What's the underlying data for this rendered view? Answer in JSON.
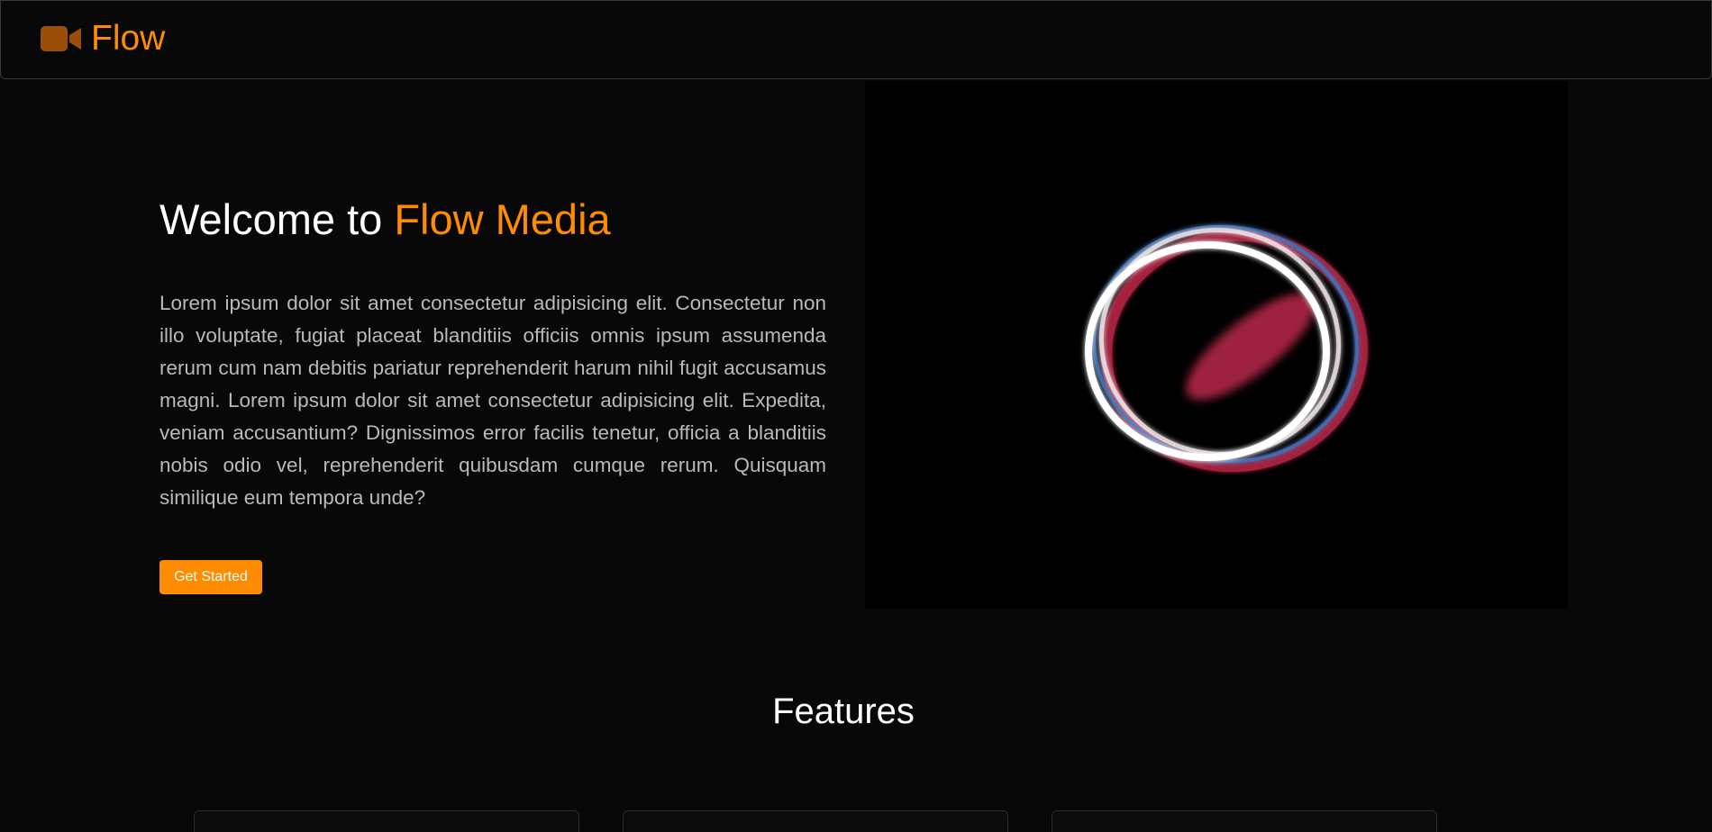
{
  "nav": {
    "brand": "Flow",
    "brand_icon": "video-camera-icon",
    "accent_color": "#ff8c00"
  },
  "hero": {
    "title_prefix": "Welcome to ",
    "title_highlight": "Flow Media",
    "description": "Lorem ipsum dolor sit amet consectetur adipisicing elit. Consectetur non illo voluptate, fugiat placeat blanditiis officiis omnis ipsum assumenda rerum cum nam debitis pariatur reprehenderit harum nihil fugit accusamus magni. Lorem ipsum dolor sit amet consectetur adipisicing elit. Expedita, veniam accusantium? Dignissimos error facilis tenetur, officia a blanditiis nobis odio vel, reprehenderit quibusdam cumque rerum. Quisquam similique eum tempora unde?",
    "cta_label": "Get Started"
  },
  "features": {
    "title": "Features",
    "cards": 3
  }
}
